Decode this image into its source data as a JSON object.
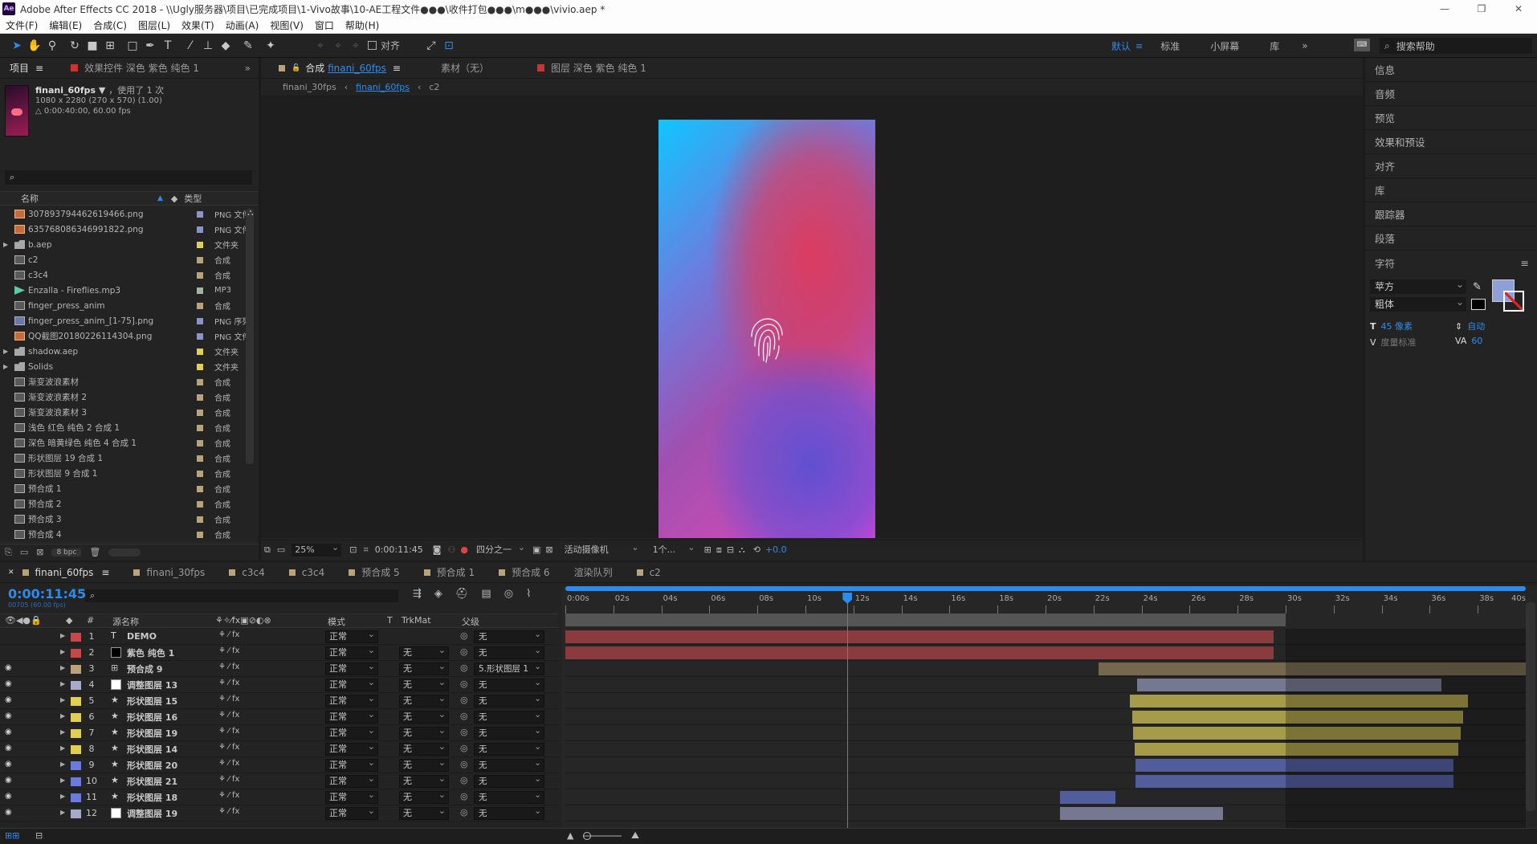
{
  "app": {
    "logo": "Ae",
    "title": "Adobe After Effects CC 2018 - \\\\Ugly服务器\\项目\\已完成项目\\1-Vivo故事\\10-AE工程文件●●●\\收件打包●●●\\m●●●\\vivio.aep *",
    "window_buttons": [
      "—",
      "❐",
      "✕"
    ]
  },
  "menu": [
    "文件(F)",
    "编辑(E)",
    "合成(C)",
    "图层(L)",
    "效果(T)",
    "动画(A)",
    "视图(V)",
    "窗口",
    "帮助(H)"
  ],
  "toolbar": {
    "snap_label": "对齐",
    "workspaces": [
      "默认",
      "标准",
      "小屏幕",
      "库"
    ],
    "active_workspace": "默认",
    "more": "»",
    "search_placeholder": "搜索帮助"
  },
  "project_panel": {
    "tab_label": "项目",
    "effects_tab": "效果控件 深色 紫色 纯色 1",
    "more": "»",
    "item_name": "finani_60fps",
    "item_used": "，使用了 1 次",
    "item_size": "1080 x 2280  (270 x 570) (1.00)",
    "item_duration": "△ 0:00:40:00, 60.00 fps",
    "search_icon_label": "⌕",
    "col_name": "名称",
    "col_type": "类型",
    "bpc": "8 bpc",
    "items": [
      {
        "name": "307893794462619466.png",
        "type": "PNG 文件",
        "kind": "png",
        "label": "#8b93c8"
      },
      {
        "name": "635768086346991822.png",
        "type": "PNG 文件",
        "kind": "png",
        "label": "#8b93c8"
      },
      {
        "name": "b.aep",
        "type": "文件夹",
        "kind": "folder",
        "label": "#e0cf55"
      },
      {
        "name": "c2",
        "type": "合成",
        "kind": "comp",
        "label": "#b8a37a"
      },
      {
        "name": "c3c4",
        "type": "合成",
        "kind": "comp",
        "label": "#b8a37a"
      },
      {
        "name": "Enzalla - Fireflies.mp3",
        "type": "MP3",
        "kind": "audio",
        "label": "#9fb7a0"
      },
      {
        "name": "finger_press_anim",
        "type": "合成",
        "kind": "comp",
        "label": "#b8a37a"
      },
      {
        "name": "finger_press_anim_[1-75].png",
        "type": "PNG 序列",
        "kind": "seq",
        "label": "#8b93c8"
      },
      {
        "name": "QQ截图20180226114304.png",
        "type": "PNG 文件",
        "kind": "png",
        "label": "#8b93c8"
      },
      {
        "name": "shadow.aep",
        "type": "文件夹",
        "kind": "folder",
        "label": "#e0cf55"
      },
      {
        "name": "Solids",
        "type": "文件夹",
        "kind": "folder",
        "label": "#e0cf55"
      },
      {
        "name": "渐变波浪素材",
        "type": "合成",
        "kind": "comp",
        "label": "#b8a37a"
      },
      {
        "name": "渐变波浪素材 2",
        "type": "合成",
        "kind": "comp",
        "label": "#b8a37a"
      },
      {
        "name": "渐变波浪素材 3",
        "type": "合成",
        "kind": "comp",
        "label": "#b8a37a"
      },
      {
        "name": "浅色 红色 纯色 2 合成 1",
        "type": "合成",
        "kind": "comp",
        "label": "#b8a37a"
      },
      {
        "name": "深色 暗黄绿色 纯色 4 合成 1",
        "type": "合成",
        "kind": "comp",
        "label": "#b8a37a"
      },
      {
        "name": "形状图层 19 合成 1",
        "type": "合成",
        "kind": "comp",
        "label": "#b8a37a"
      },
      {
        "name": "形状图层 9 合成 1",
        "type": "合成",
        "kind": "comp",
        "label": "#b8a37a"
      },
      {
        "name": "预合成 1",
        "type": "合成",
        "kind": "comp",
        "label": "#b8a37a"
      },
      {
        "name": "预合成 2",
        "type": "合成",
        "kind": "comp",
        "label": "#b8a37a"
      },
      {
        "name": "预合成 3",
        "type": "合成",
        "kind": "comp",
        "label": "#b8a37a"
      },
      {
        "name": "预合成 4",
        "type": "合成",
        "kind": "comp",
        "label": "#b8a37a"
      }
    ]
  },
  "comp_panel": {
    "tab_prefix": "合成",
    "tab_name": "finani_60fps",
    "footage_tab": "素材（无）",
    "layer_tab": "图层 深色 紫色 纯色 1",
    "breadcrumbs": [
      "finani_30fps",
      "finani_60fps",
      "c2"
    ],
    "zoom": "25%",
    "timecode": "0:00:11:45",
    "resolution": "四分之一",
    "camera": "活动摄像机",
    "views": "1个...",
    "exposure": "+0.0"
  },
  "right_panel": {
    "items": [
      "信息",
      "音频",
      "预览",
      "效果和预设",
      "对齐",
      "库",
      "跟踪器",
      "段落"
    ],
    "character": {
      "title": "字符",
      "font": "苹方",
      "style": "粗体",
      "size": "45 像素",
      "leading": "自动",
      "kerning": "度量标准",
      "tracking": "60",
      "fill_color": "#8ea0d8"
    }
  },
  "timeline": {
    "tabs": [
      "finani_60fps",
      "finani_30fps",
      "c3c4",
      "c3c4",
      "预合成 5",
      "预合成 1",
      "预合成 6",
      "渲染队列",
      "c2"
    ],
    "tab_colors": [
      "#b8a37a",
      "#b8a37a",
      "#b8a37a",
      "#b8a37a",
      "#b8a37a",
      "#b8a37a",
      "#b8a37a",
      "",
      "#b8a37a"
    ],
    "timecode": "0:00:11:45",
    "frame_info": "00705 (60.00 fps)",
    "col_source": "源名称",
    "col_mode": "模式",
    "col_t": "T",
    "col_trkmat": "TrkMat",
    "col_parent": "父级",
    "ruler": [
      "0:00s",
      "02s",
      "04s",
      "06s",
      "08s",
      "10s",
      "12s",
      "14s",
      "16s",
      "18s",
      "20s",
      "22s",
      "24s",
      "26s",
      "28s",
      "30s",
      "32s",
      "34s",
      "36s",
      "38s",
      "40s"
    ],
    "duration_seconds": 40,
    "current_time_seconds": 11.75,
    "work_area_end_seconds": 30,
    "layers": [
      {
        "num": "1",
        "name": "DEMO",
        "kind": "text",
        "label": "#c44a4a",
        "mode": "正常",
        "trkmat": "",
        "parent": "无",
        "start": 0,
        "end": 29.5,
        "bar": "#8b3a3d",
        "visible": false
      },
      {
        "num": "2",
        "name": "紫色 纯色 1",
        "kind": "solid",
        "label": "#c44a4a",
        "mode": "正常",
        "trkmat": "无",
        "parent": "无",
        "start": 0,
        "end": 29.5,
        "bar": "#8b3a3d",
        "visible": false
      },
      {
        "num": "3",
        "name": "预合成 9",
        "kind": "comp",
        "label": "#b8a37a",
        "mode": "正常",
        "trkmat": "无",
        "parent": "5.形状图层 1",
        "start": 22.2,
        "end": 40,
        "bar": "#75684f",
        "visible": true
      },
      {
        "num": "4",
        "name": "调整图层 13",
        "kind": "adjust",
        "label": "#a8aac8",
        "mode": "正常",
        "trkmat": "无",
        "parent": "无",
        "start": 23.8,
        "end": 36.5,
        "bar": "#767891",
        "visible": true
      },
      {
        "num": "5",
        "name": "形状图层 15",
        "kind": "shape",
        "label": "#e0cf55",
        "mode": "正常",
        "trkmat": "无",
        "parent": "无",
        "start": 23.5,
        "end": 37.6,
        "bar": "#a59b48",
        "visible": true
      },
      {
        "num": "6",
        "name": "形状图层 16",
        "kind": "shape",
        "label": "#e0cf55",
        "mode": "正常",
        "trkmat": "无",
        "parent": "无",
        "start": 23.6,
        "end": 37.4,
        "bar": "#a59b48",
        "visible": true
      },
      {
        "num": "7",
        "name": "形状图层 19",
        "kind": "shape",
        "label": "#e0cf55",
        "mode": "正常",
        "trkmat": "无",
        "parent": "无",
        "start": 23.65,
        "end": 37.3,
        "bar": "#a59b48",
        "visible": true
      },
      {
        "num": "8",
        "name": "形状图层 14",
        "kind": "shape",
        "label": "#e0cf55",
        "mode": "正常",
        "trkmat": "无",
        "parent": "无",
        "start": 23.7,
        "end": 37.2,
        "bar": "#a59b48",
        "visible": true
      },
      {
        "num": "9",
        "name": "形状图层 20",
        "kind": "shape",
        "label": "#6b7bdc",
        "mode": "正常",
        "trkmat": "无",
        "parent": "无",
        "start": 23.75,
        "end": 37.0,
        "bar": "#525d9c",
        "visible": true
      },
      {
        "num": "10",
        "name": "形状图层 21",
        "kind": "shape",
        "label": "#6b7bdc",
        "mode": "正常",
        "trkmat": "无",
        "parent": "无",
        "start": 23.75,
        "end": 37.0,
        "bar": "#525d9c",
        "visible": true
      },
      {
        "num": "11",
        "name": "形状图层 18",
        "kind": "shape",
        "label": "#6b7bdc",
        "mode": "正常",
        "trkmat": "无",
        "parent": "无",
        "start": 20.6,
        "end": 22.9,
        "bar": "#525d9c",
        "visible": true
      },
      {
        "num": "12",
        "name": "调整图层 19",
        "kind": "adjust",
        "label": "#a8aac8",
        "mode": "正常",
        "trkmat": "无",
        "parent": "无",
        "start": 20.6,
        "end": 27.4,
        "bar": "#767891",
        "visible": true
      }
    ]
  }
}
